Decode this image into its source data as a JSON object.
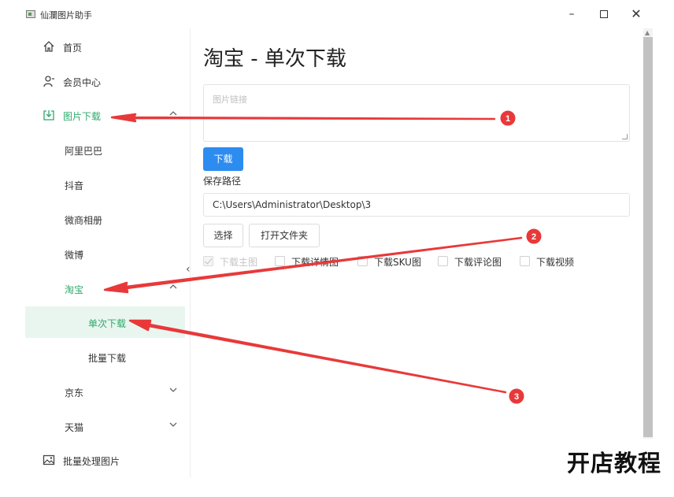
{
  "window": {
    "title": "仙瀾图片助手",
    "minimize": "–",
    "close": "✕"
  },
  "sidebar": {
    "home": "首页",
    "member": "会员中心",
    "image_download": "图片下载",
    "alibaba": "阿里巴巴",
    "douyin": "抖音",
    "weishang": "微商相册",
    "weibo": "微博",
    "taobao": "淘宝",
    "single_download": "单次下载",
    "batch_download": "批量下载",
    "jd": "京东",
    "tmall": "天猫",
    "batch_process": "批量处理图片",
    "collapse": "‹"
  },
  "main": {
    "title": "淘宝 - 单次下载",
    "link_placeholder": "图片链接",
    "download_button": "下载",
    "save_path_label": "保存路径",
    "save_path_value": "C:\\Users\\Administrator\\Desktop\\3",
    "choose_button": "选择",
    "open_folder_button": "打开文件夹",
    "options": [
      {
        "label": "下载主图",
        "checked": true,
        "disabled": true
      },
      {
        "label": "下载详情图",
        "checked": false,
        "disabled": false
      },
      {
        "label": "下载SKU图",
        "checked": false,
        "disabled": false
      },
      {
        "label": "下载评论图",
        "checked": false,
        "disabled": false
      },
      {
        "label": "下载视频",
        "checked": false,
        "disabled": false
      }
    ]
  },
  "annotations": {
    "marker_1": "1",
    "marker_2": "2",
    "marker_3": "3",
    "arrow_color": "#e8393a"
  },
  "watermark": "开店教程"
}
